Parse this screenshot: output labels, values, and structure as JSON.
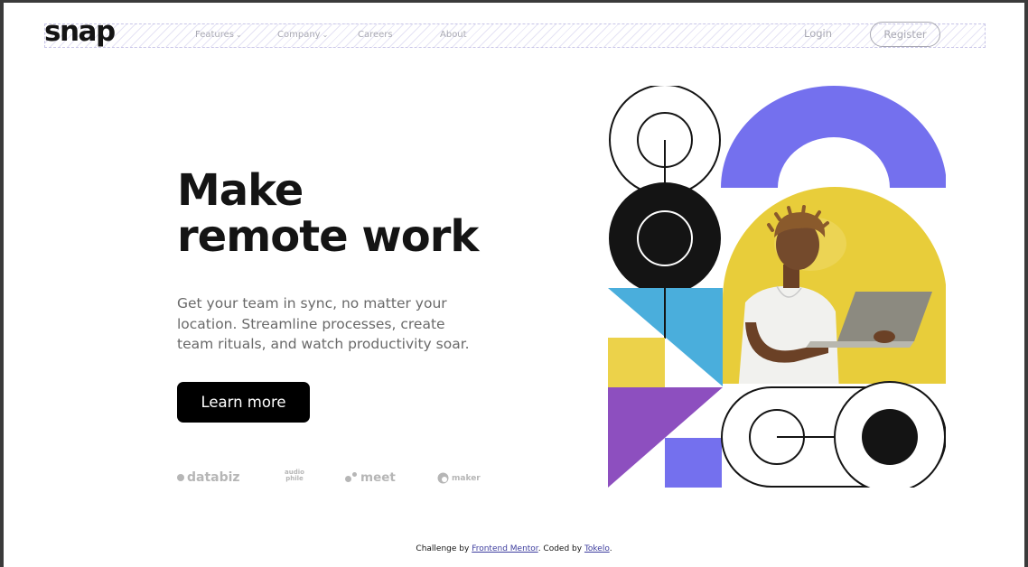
{
  "logo": "snap",
  "nav": {
    "items": [
      {
        "label": "Features",
        "has_dropdown": true
      },
      {
        "label": "Company",
        "has_dropdown": true
      },
      {
        "label": "Careers",
        "has_dropdown": false
      },
      {
        "label": "About",
        "has_dropdown": false
      }
    ],
    "login": "Login",
    "register": "Register"
  },
  "hero": {
    "title_line1": "Make",
    "title_line2": "remote work",
    "description": "Get your team in sync, no matter your location. Streamline processes, create team rituals, and watch productivity soar.",
    "cta": "Learn more"
  },
  "clients": {
    "databiz": "databiz",
    "audiophile_line1": "audio",
    "audiophile_line2": "phile",
    "meet": "meet",
    "maker": "maker"
  },
  "footer": {
    "prefix": "Challenge by ",
    "link1": "Frontend Mentor",
    "middle": ". Coded by ",
    "link2": "Tokelo",
    "suffix": "."
  },
  "colors": {
    "purple": "#7470ee",
    "yellow": "#ecd24a",
    "blue": "#4aaedc",
    "violet": "#8d4fbf",
    "black": "#141414"
  },
  "icons": {
    "dropdown": "chevron-down-icon"
  }
}
